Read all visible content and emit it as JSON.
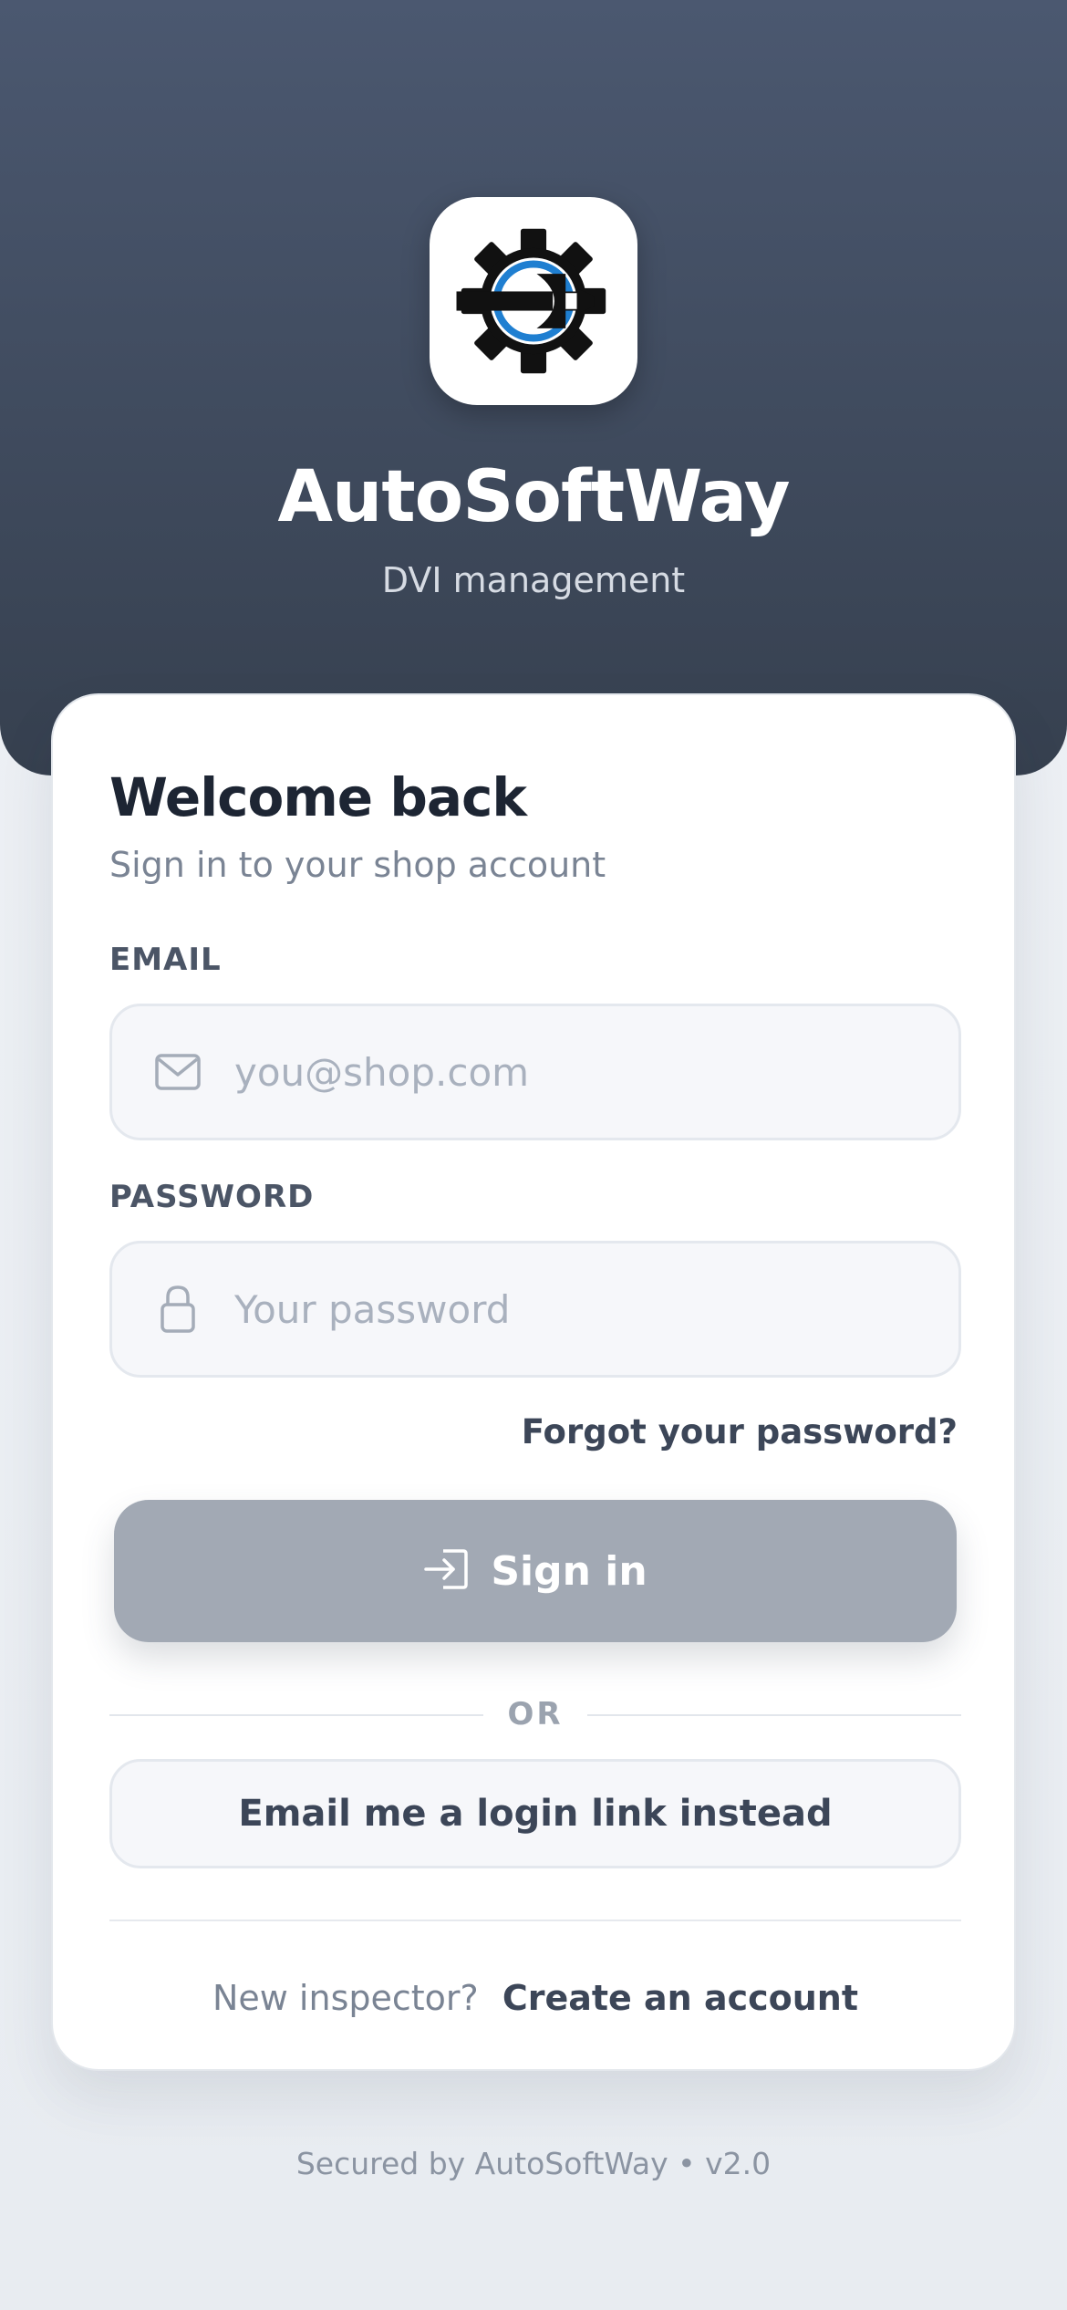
{
  "app": {
    "title": "AutoSoftWay",
    "subtitle": "DVI management",
    "logo_icon": "gear-wrench-icon"
  },
  "card": {
    "heading": "Welcome back",
    "subheading": "Sign in to your shop account"
  },
  "email": {
    "label": "EMAIL",
    "placeholder": "you@shop.com",
    "value": "",
    "icon": "mail-icon"
  },
  "password": {
    "label": "PASSWORD",
    "placeholder": "Your password",
    "value": "",
    "icon": "lock-icon"
  },
  "forgot_label": "Forgot your password?",
  "signin": {
    "label": "Sign in",
    "icon": "login-icon"
  },
  "divider_text": "OR",
  "magic_link_label": "Email me a login link instead",
  "signup": {
    "question": "New inspector?",
    "link": "Create an account"
  },
  "footer": "Secured by AutoSoftWay • v2.0",
  "colors": {
    "hero_top": "#4b5870",
    "hero_bottom": "#36404f",
    "button_disabled": "#a2a9b4",
    "logo_blue": "#1f7fd1",
    "logo_dark": "#111111"
  }
}
